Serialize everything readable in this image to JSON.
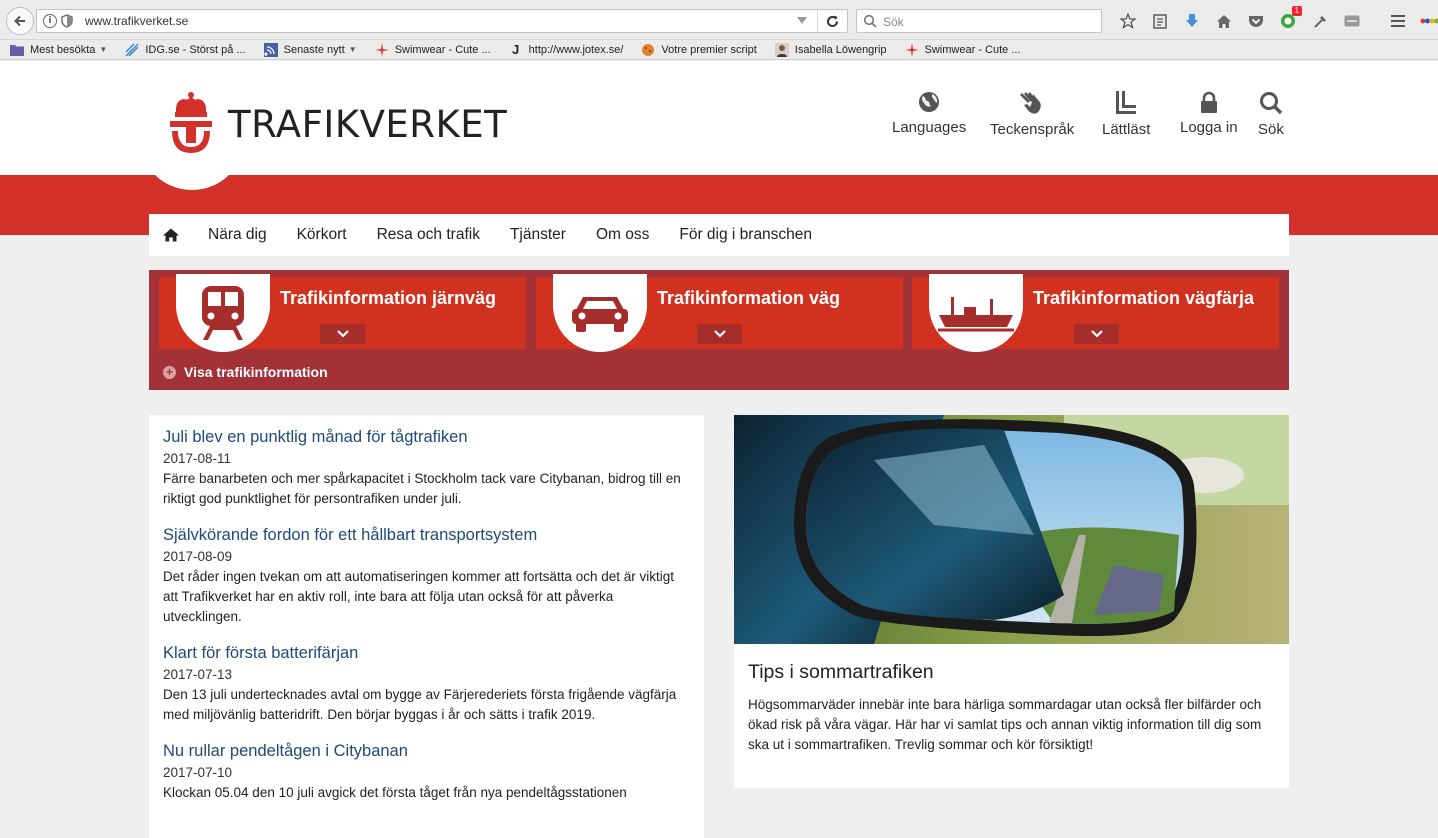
{
  "browser": {
    "url": "www.trafikverket.se",
    "search_placeholder": "Sök",
    "notification_count": "1",
    "bookmarks": [
      {
        "label": "Mest besökta",
        "has_caret": true
      },
      {
        "label": "IDG.se - Störst på ...",
        "has_caret": false
      },
      {
        "label": "Senaste nytt",
        "has_caret": true
      },
      {
        "label": "Swimwear - Cute ...",
        "has_caret": false
      },
      {
        "label": "http://www.jotex.se/",
        "has_caret": false
      },
      {
        "label": "Votre premier script",
        "has_caret": false
      },
      {
        "label": "Isabella Löwengrip",
        "has_caret": false
      },
      {
        "label": "Swimwear - Cute ...",
        "has_caret": false
      }
    ]
  },
  "site": {
    "logo_text": "TRAFIKVERKET",
    "brand_color": "#d3302a",
    "header_tools": [
      {
        "label": "Languages",
        "icon": "globe-icon"
      },
      {
        "label": "Teckenspråk",
        "icon": "sign-language-icon"
      },
      {
        "label": "Lättläst",
        "icon": "easy-read-icon"
      },
      {
        "label": "Logga in",
        "icon": "lock-icon"
      },
      {
        "label": "Sök",
        "icon": "search-icon"
      }
    ],
    "nav": [
      "Nära dig",
      "Körkort",
      "Resa och trafik",
      "Tjänster",
      "Om oss",
      "För dig i branschen"
    ]
  },
  "traffic": {
    "cards": [
      {
        "label": "Trafikinformation järnväg",
        "icon": "train-icon"
      },
      {
        "label": "Trafikinformation väg",
        "icon": "car-icon"
      },
      {
        "label": "Trafikinformation vägfärja",
        "icon": "ferry-icon"
      }
    ],
    "show_label": "Visa trafikinformation"
  },
  "news": [
    {
      "title": "Juli blev en punktlig månad för tågtrafiken",
      "date": "2017-08-11",
      "text": "Färre banarbeten och mer spårkapacitet i Stockholm tack vare Citybanan, bidrog till en riktigt god punktlighet för persontrafiken under juli."
    },
    {
      "title": "Självkörande fordon för ett hållbart transportsystem",
      "date": "2017-08-09",
      "text": "Det råder ingen tvekan om att automatiseringen kommer att fortsätta och det är viktigt att Trafikverket har en aktiv roll, inte bara att följa utan också för att påverka utvecklingen."
    },
    {
      "title": "Klart för första batterifärjan",
      "date": "2017-07-13",
      "text": "Den 13 juli undertecknades avtal om bygge av Färjerederiets första frigående vägfärja med miljövänlig batteridrift. Den börjar byggas i år och sätts i trafik 2019."
    },
    {
      "title": "Nu rullar pendeltågen i Citybanan",
      "date": "2017-07-10",
      "text": "Klockan 05.04 den 10 juli avgick det första tåget från nya pendeltågsstationen"
    }
  ],
  "feature": {
    "title": "Tips i sommartrafiken",
    "text": "Högsommarväder innebär inte bara härliga sommardagar utan också fler bilfärder och ökad risk på våra vägar. Här har vi samlat tips och annan viktig information till dig som ska ut i sommartrafiken. Trevlig sommar och kör försiktigt!"
  }
}
